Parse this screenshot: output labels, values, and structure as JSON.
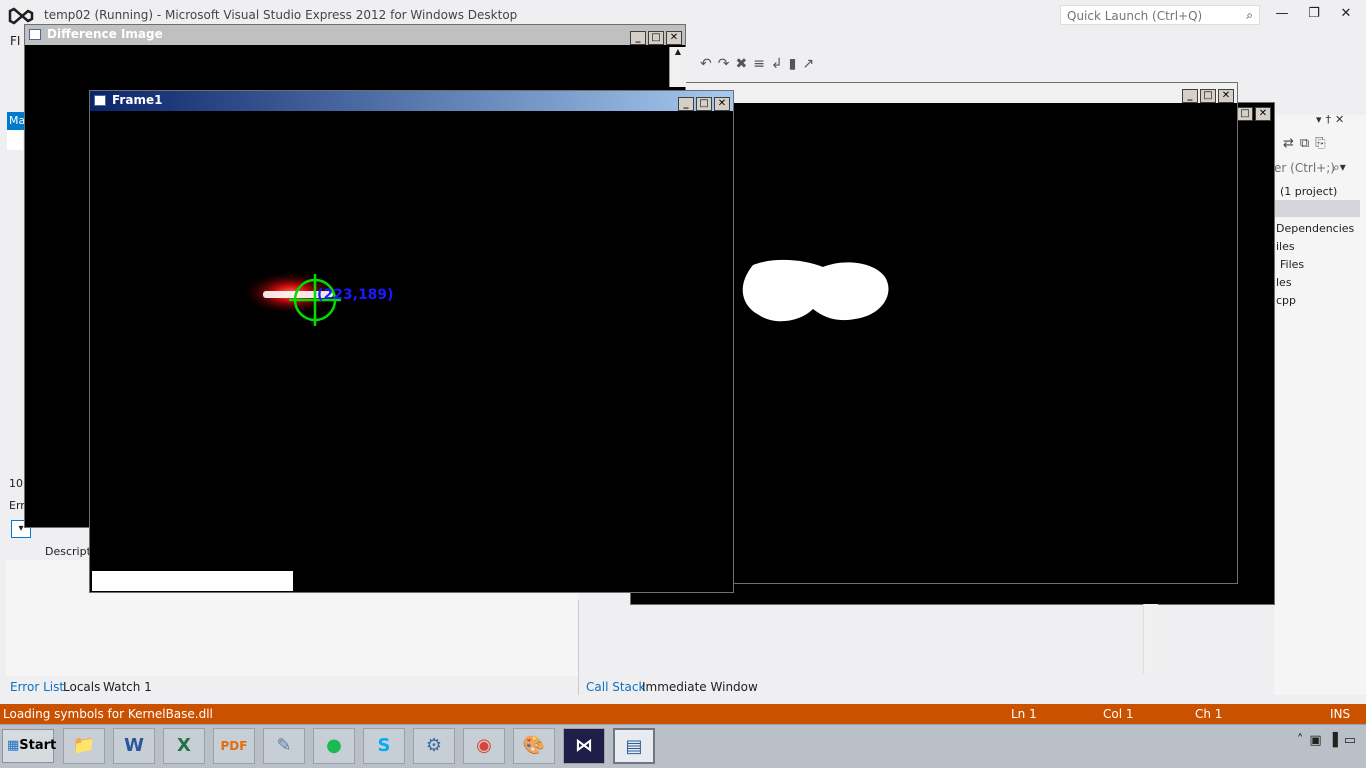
{
  "vs": {
    "title": "temp02 (Running) - Microsoft Visual Studio Express 2012 for Windows Desktop",
    "quick_launch_placeholder": "Quick Launch (Ctrl+Q)",
    "menu_partial": "FI",
    "left_tab_partial": "Ma",
    "left_zoom_partial": "10",
    "left_err_partial": "Err",
    "left_descr_partial": "Descripti",
    "window_controls": {
      "minimize": "—",
      "restore": "❐",
      "close": "✕"
    }
  },
  "windows": {
    "difference": {
      "title": "Difference Image"
    },
    "frame1": {
      "title": "Frame1",
      "overlay_text": "(223,189)"
    },
    "threshold": {
      "title": ""
    }
  },
  "bottom_tabs": {
    "error_list": "Error List",
    "locals": "Locals",
    "watch1": "Watch 1",
    "call_stack": "Call Stack",
    "immediate": "Immediate Window"
  },
  "solution": {
    "search_partial": "er (Ctrl+;)",
    "items": [
      "(1 project)",
      "Dependencies",
      "iles",
      "Files",
      "les",
      "cpp"
    ]
  },
  "status": {
    "message": "Loading symbols for KernelBase.dll",
    "ln": "Ln 1",
    "col": "Col 1",
    "ch": "Ch 1",
    "mode": "INS"
  },
  "taskbar": {
    "start_label": "Start",
    "apps": [
      "file-explorer-icon",
      "word-icon",
      "excel-icon",
      "pdf-icon",
      "notepad-icon",
      "spotify-icon",
      "skype-icon",
      "control-panel-icon",
      "chrome-icon",
      "paint-icon",
      "visual-studio-icon",
      "window-app-icon"
    ]
  },
  "colors": {
    "accent": "#007acc",
    "status_bar": "#ca5100",
    "marker": "#00ff00",
    "label": "#1a1aff"
  }
}
